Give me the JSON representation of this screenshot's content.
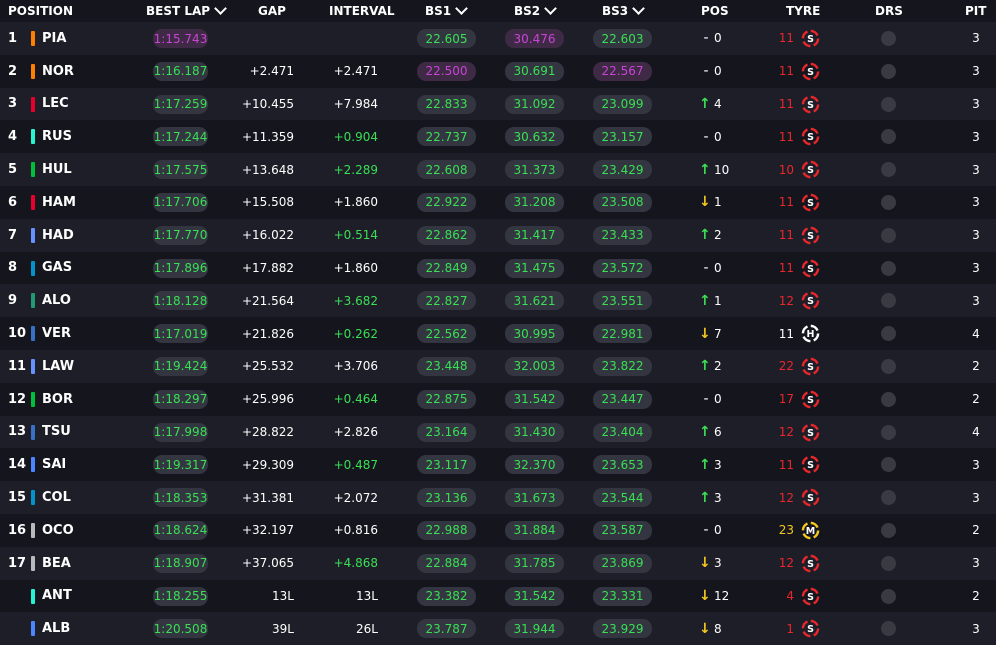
{
  "headers": {
    "position": "POSITION",
    "best_lap": "BEST LAP",
    "gap": "GAP",
    "interval": "INTERVAL",
    "bs1": "BS1",
    "bs2": "BS2",
    "bs3": "BS3",
    "pos": "POS",
    "tyre": "TYRE",
    "drs": "DRS",
    "pit": "PIT"
  },
  "colors": {
    "green": "#3adf54",
    "purple": "#c744d6",
    "soft": "#e8272a",
    "hard": "#ffffff",
    "medium": "#f3c91d",
    "up": "#3adf54",
    "down": "#f3c91d"
  },
  "rows": [
    {
      "pos": "1",
      "code": "PIA",
      "team": "#ff8000",
      "best": "1:15.743",
      "bestc": "purple",
      "gap": "",
      "int": "",
      "intc": "white",
      "bs1": "22.605",
      "bs1c": "green",
      "bs2": "30.476",
      "bs2c": "purple",
      "bs3": "22.603",
      "bs3c": "green",
      "dir": "-",
      "change": "0",
      "age": "11",
      "tyre": "S",
      "pit": "3"
    },
    {
      "pos": "2",
      "code": "NOR",
      "team": "#ff8000",
      "best": "1:16.187",
      "bestc": "green",
      "gap": "+2.471",
      "int": "+2.471",
      "intc": "white",
      "bs1": "22.500",
      "bs1c": "purple",
      "bs2": "30.691",
      "bs2c": "green",
      "bs3": "22.567",
      "bs3c": "purple",
      "dir": "-",
      "change": "0",
      "age": "11",
      "tyre": "S",
      "pit": "3"
    },
    {
      "pos": "3",
      "code": "LEC",
      "team": "#e8002d",
      "best": "1:17.259",
      "bestc": "green",
      "gap": "+10.455",
      "int": "+7.984",
      "intc": "white",
      "bs1": "22.833",
      "bs1c": "green",
      "bs2": "31.092",
      "bs2c": "green",
      "bs3": "23.099",
      "bs3c": "green",
      "dir": "up",
      "change": "4",
      "age": "11",
      "tyre": "S",
      "pit": "3"
    },
    {
      "pos": "4",
      "code": "RUS",
      "team": "#27f4d2",
      "best": "1:17.244",
      "bestc": "green",
      "gap": "+11.359",
      "int": "+0.904",
      "intc": "green",
      "bs1": "22.737",
      "bs1c": "green",
      "bs2": "30.632",
      "bs2c": "green",
      "bs3": "23.157",
      "bs3c": "green",
      "dir": "-",
      "change": "0",
      "age": "11",
      "tyre": "S",
      "pit": "3"
    },
    {
      "pos": "5",
      "code": "HUL",
      "team": "#00c03a",
      "best": "1:17.575",
      "bestc": "green",
      "gap": "+13.648",
      "int": "+2.289",
      "intc": "green",
      "bs1": "22.608",
      "bs1c": "green",
      "bs2": "31.373",
      "bs2c": "green",
      "bs3": "23.429",
      "bs3c": "green",
      "dir": "up",
      "change": "10",
      "age": "10",
      "tyre": "S",
      "pit": "3"
    },
    {
      "pos": "6",
      "code": "HAM",
      "team": "#e8002d",
      "best": "1:17.706",
      "bestc": "green",
      "gap": "+15.508",
      "int": "+1.860",
      "intc": "white",
      "bs1": "22.922",
      "bs1c": "green",
      "bs2": "31.208",
      "bs2c": "green",
      "bs3": "23.508",
      "bs3c": "green",
      "dir": "down",
      "change": "1",
      "age": "11",
      "tyre": "S",
      "pit": "3"
    },
    {
      "pos": "7",
      "code": "HAD",
      "team": "#6692ff",
      "best": "1:17.770",
      "bestc": "green",
      "gap": "+16.022",
      "int": "+0.514",
      "intc": "green",
      "bs1": "22.862",
      "bs1c": "green",
      "bs2": "31.417",
      "bs2c": "green",
      "bs3": "23.433",
      "bs3c": "green",
      "dir": "up",
      "change": "2",
      "age": "11",
      "tyre": "S",
      "pit": "3"
    },
    {
      "pos": "8",
      "code": "GAS",
      "team": "#0093cc",
      "best": "1:17.896",
      "bestc": "green",
      "gap": "+17.882",
      "int": "+1.860",
      "intc": "white",
      "bs1": "22.849",
      "bs1c": "green",
      "bs2": "31.475",
      "bs2c": "green",
      "bs3": "23.572",
      "bs3c": "green",
      "dir": "-",
      "change": "0",
      "age": "11",
      "tyre": "S",
      "pit": "3"
    },
    {
      "pos": "9",
      "code": "ALO",
      "team": "#229971",
      "best": "1:18.128",
      "bestc": "green",
      "gap": "+21.564",
      "int": "+3.682",
      "intc": "green",
      "bs1": "22.827",
      "bs1c": "green",
      "bs2": "31.621",
      "bs2c": "green",
      "bs3": "23.551",
      "bs3c": "green",
      "dir": "up",
      "change": "1",
      "age": "12",
      "tyre": "S",
      "pit": "3"
    },
    {
      "pos": "10",
      "code": "VER",
      "team": "#3671c6",
      "best": "1:17.019",
      "bestc": "green",
      "gap": "+21.826",
      "int": "+0.262",
      "intc": "green",
      "bs1": "22.562",
      "bs1c": "green",
      "bs2": "30.995",
      "bs2c": "green",
      "bs3": "22.981",
      "bs3c": "green",
      "dir": "down",
      "change": "7",
      "age": "11",
      "tyre": "H",
      "pit": "4"
    },
    {
      "pos": "11",
      "code": "LAW",
      "team": "#6692ff",
      "best": "1:19.424",
      "bestc": "green",
      "gap": "+25.532",
      "int": "+3.706",
      "intc": "white",
      "bs1": "23.448",
      "bs1c": "green",
      "bs2": "32.003",
      "bs2c": "green",
      "bs3": "23.822",
      "bs3c": "green",
      "dir": "up",
      "change": "2",
      "age": "22",
      "tyre": "S",
      "pit": "2"
    },
    {
      "pos": "12",
      "code": "BOR",
      "team": "#00c03a",
      "best": "1:18.297",
      "bestc": "green",
      "gap": "+25.996",
      "int": "+0.464",
      "intc": "green",
      "bs1": "22.875",
      "bs1c": "green",
      "bs2": "31.542",
      "bs2c": "green",
      "bs3": "23.447",
      "bs3c": "green",
      "dir": "-",
      "change": "0",
      "age": "17",
      "tyre": "S",
      "pit": "2"
    },
    {
      "pos": "13",
      "code": "TSU",
      "team": "#3671c6",
      "best": "1:17.998",
      "bestc": "green",
      "gap": "+28.822",
      "int": "+2.826",
      "intc": "white",
      "bs1": "23.164",
      "bs1c": "green",
      "bs2": "31.430",
      "bs2c": "green",
      "bs3": "23.404",
      "bs3c": "green",
      "dir": "up",
      "change": "6",
      "age": "12",
      "tyre": "S",
      "pit": "4"
    },
    {
      "pos": "14",
      "code": "SAI",
      "team": "#4a86ff",
      "best": "1:19.317",
      "bestc": "green",
      "gap": "+29.309",
      "int": "+0.487",
      "intc": "green",
      "bs1": "23.117",
      "bs1c": "green",
      "bs2": "32.370",
      "bs2c": "green",
      "bs3": "23.653",
      "bs3c": "green",
      "dir": "up",
      "change": "3",
      "age": "11",
      "tyre": "S",
      "pit": "3"
    },
    {
      "pos": "15",
      "code": "COL",
      "team": "#0093cc",
      "best": "1:18.353",
      "bestc": "green",
      "gap": "+31.381",
      "int": "+2.072",
      "intc": "white",
      "bs1": "23.136",
      "bs1c": "green",
      "bs2": "31.673",
      "bs2c": "green",
      "bs3": "23.544",
      "bs3c": "green",
      "dir": "up",
      "change": "3",
      "age": "12",
      "tyre": "S",
      "pit": "3"
    },
    {
      "pos": "16",
      "code": "OCO",
      "team": "#b6babd",
      "best": "1:18.624",
      "bestc": "green",
      "gap": "+32.197",
      "int": "+0.816",
      "intc": "white",
      "bs1": "22.988",
      "bs1c": "green",
      "bs2": "31.884",
      "bs2c": "green",
      "bs3": "23.587",
      "bs3c": "green",
      "dir": "-",
      "change": "0",
      "age": "23",
      "tyre": "M",
      "pit": "2"
    },
    {
      "pos": "17",
      "code": "BEA",
      "team": "#b6babd",
      "best": "1:18.907",
      "bestc": "green",
      "gap": "+37.065",
      "int": "+4.868",
      "intc": "green",
      "bs1": "22.884",
      "bs1c": "green",
      "bs2": "31.785",
      "bs2c": "green",
      "bs3": "23.869",
      "bs3c": "green",
      "dir": "down",
      "change": "3",
      "age": "12",
      "tyre": "S",
      "pit": "3"
    },
    {
      "pos": "",
      "code": "ANT",
      "team": "#27f4d2",
      "best": "1:18.255",
      "bestc": "green",
      "gap": "13L",
      "int": "13L",
      "intc": "white",
      "bs1": "23.382",
      "bs1c": "green",
      "bs2": "31.542",
      "bs2c": "green",
      "bs3": "23.331",
      "bs3c": "green",
      "dir": "down",
      "change": "12",
      "age": "4",
      "tyre": "S",
      "pit": "2"
    },
    {
      "pos": "",
      "code": "ALB",
      "team": "#4a86ff",
      "best": "1:20.508",
      "bestc": "green",
      "gap": "39L",
      "int": "26L",
      "intc": "white",
      "bs1": "23.787",
      "bs1c": "green",
      "bs2": "31.944",
      "bs2c": "green",
      "bs3": "23.929",
      "bs3c": "green",
      "dir": "down",
      "change": "8",
      "age": "1",
      "tyre": "S",
      "pit": "3"
    }
  ]
}
